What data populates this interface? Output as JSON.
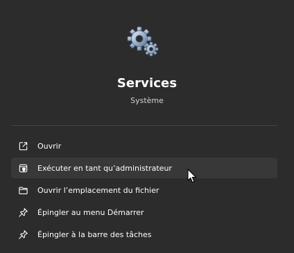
{
  "app": {
    "title": "Services",
    "subtitle": "Système",
    "icon": "services-gear-icon"
  },
  "menu": {
    "items": [
      {
        "label": "Ouvrir",
        "icon": "open-external-icon"
      },
      {
        "label": "Exécuter en tant qu’administrateur",
        "icon": "run-as-admin-icon",
        "hovered": true
      },
      {
        "label": "Ouvrir l’emplacement du fichier",
        "icon": "folder-icon"
      },
      {
        "label": "Épingler au menu Démarrer",
        "icon": "pin-icon"
      },
      {
        "label": "Épingler à la barre des tâches",
        "icon": "pin-icon"
      }
    ]
  },
  "colors": {
    "background": "#2c2c2c",
    "hover": "#383838",
    "divider": "#454545",
    "text": "#ffffff"
  }
}
